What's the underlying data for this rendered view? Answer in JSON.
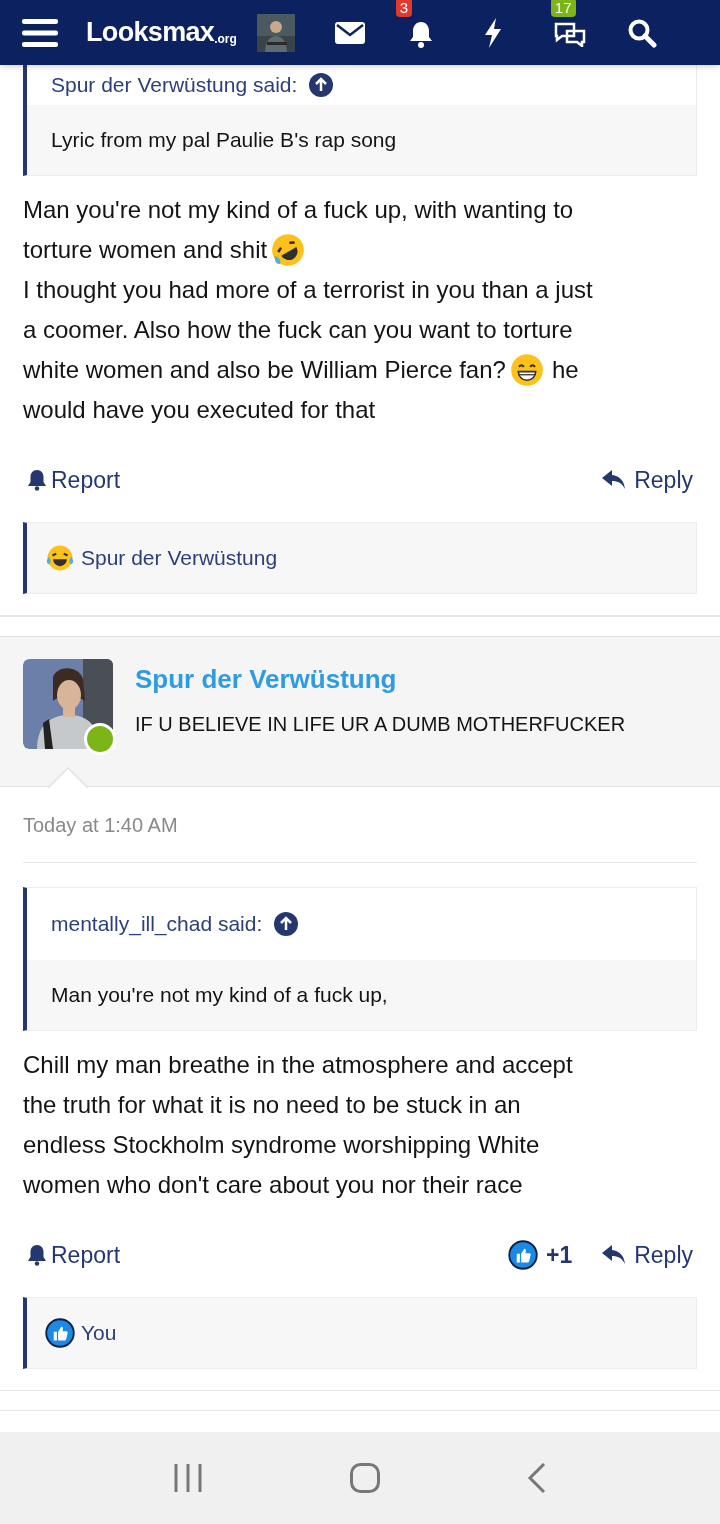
{
  "header": {
    "logo": "Looksmax",
    "logo_suffix": ".org",
    "alerts_badge": "3",
    "conversations_badge": "17"
  },
  "posts": [
    {
      "quote": {
        "attribution": "Spur der Verwüstung said:",
        "text": "Lyric from my pal Paulie B's rap song"
      },
      "body": [
        [
          {
            "kind": "text",
            "text": "Man you're not my kind of a fuck up, with wanting to"
          }
        ],
        [
          {
            "kind": "text",
            "text": "torture women and shit"
          },
          {
            "kind": "rofl"
          }
        ],
        [
          {
            "kind": "text",
            "text": "I thought you had more of a terrorist in you than a just"
          }
        ],
        [
          {
            "kind": "text",
            "text": "a coomer. Also how the fuck can you want to torture"
          }
        ],
        [
          {
            "kind": "text",
            "text": "white women and also be William Pierce fan?"
          },
          {
            "kind": "grin"
          },
          {
            "kind": "text",
            "text": "he"
          }
        ],
        [
          {
            "kind": "text",
            "text": "would have you executed for that"
          }
        ]
      ],
      "actions": {
        "report": "Report",
        "reply": "Reply"
      },
      "reactions": {
        "kind": "laugh",
        "text": "Spur der Verwüstung"
      }
    },
    {
      "author": {
        "name": "Spur der Verwüstung",
        "title": "IF U BELIEVE IN LIFE UR A DUMB MOTHERFUCKER",
        "online": true,
        "time": "Today at 1:40 AM"
      },
      "quote": {
        "attribution": "mentally_ill_chad said:",
        "text": "Man you're not my kind of a fuck up,"
      },
      "body": [
        [
          {
            "kind": "text",
            "text": "Chill my man breathe in the atmosphere and accept"
          }
        ],
        [
          {
            "kind": "text",
            "text": "the truth for what it is no need to be stuck in an"
          }
        ],
        [
          {
            "kind": "text",
            "text": "endless Stockholm syndrome worshipping White"
          }
        ],
        [
          {
            "kind": "text",
            "text": "women who don't care about you nor their race"
          }
        ]
      ],
      "actions": {
        "report": "Report",
        "likes": "+1",
        "reply": "Reply"
      },
      "reactions": {
        "kind": "like",
        "text": "You"
      }
    }
  ]
}
